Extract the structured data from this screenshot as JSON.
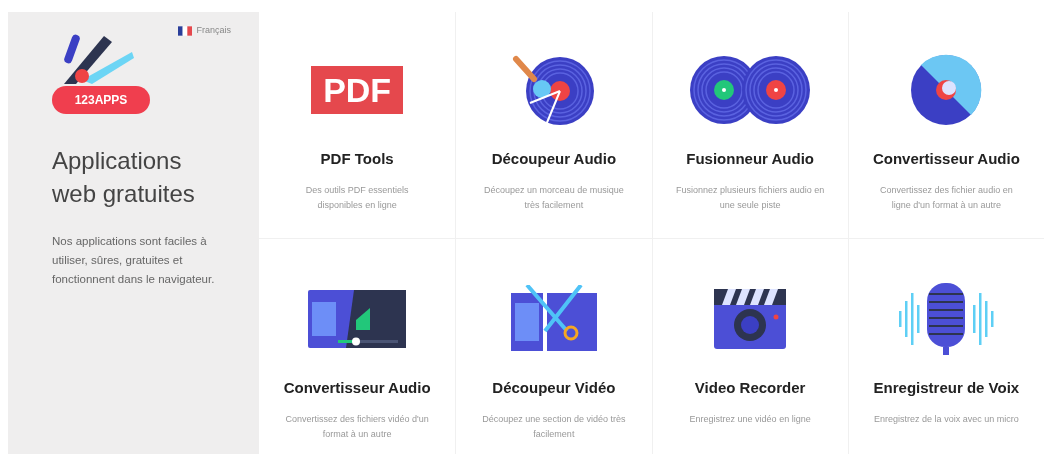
{
  "sidebar": {
    "language": "Français",
    "logo_text": "123APPS",
    "heading": "Applications web gratuites",
    "description": "Nos applications sont faciles à utiliser, sûres, gratuites et fonctionnent dans le navigateur."
  },
  "apps": [
    {
      "kind": "pdf",
      "badge": "PDF",
      "title": "PDF Tools",
      "description": "Des outils PDF essentiels disponibles en ligne"
    },
    {
      "kind": "audio-cutter",
      "title": "Découpeur Audio",
      "description": "Découpez un morceau de musique très facilement"
    },
    {
      "kind": "audio-joiner",
      "title": "Fusionneur Audio",
      "description": "Fusionnez plusieurs fichiers audio en une seule piste"
    },
    {
      "kind": "audio-converter",
      "title": "Convertisseur Audio",
      "description": "Convertissez des fichier audio en ligne d'un format à un autre"
    },
    {
      "kind": "video-converter",
      "title": "Convertisseur Audio",
      "description": "Convertissez des fichiers vidéo d'un format à un autre"
    },
    {
      "kind": "video-cutter",
      "title": "Découpeur Vidéo",
      "description": "Découpez une section de vidéo très facilement"
    },
    {
      "kind": "video-recorder",
      "title": "Video Recorder",
      "description": "Enregistrez une vidéo en ligne"
    },
    {
      "kind": "voice-recorder",
      "title": "Enregistreur de Voix",
      "description": "Enregistrez de la voix avec un micro"
    }
  ]
}
